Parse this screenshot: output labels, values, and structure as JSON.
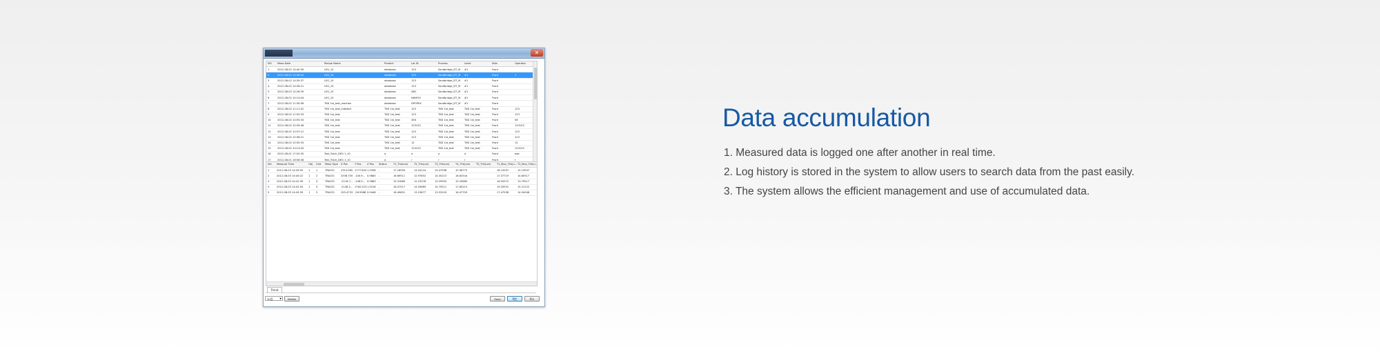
{
  "screenshot": {
    "top_table": {
      "columns": [
        "NO.",
        "Meas Date",
        "Recipe Name",
        "Product",
        "Lot ID",
        "Process",
        "Level",
        "Side",
        "Operator"
      ],
      "selected_index": 1,
      "rows": [
        [
          "1",
          "2012-08-02 14:40:39",
          "LEG_10",
          "database",
          "123",
          "Sandbridge_DT_M",
          "#1",
          "Front",
          ""
        ],
        [
          "2",
          "2012-08-02 14:36:20",
          "LEG_10",
          "database",
          "123",
          "Sandbridge_DT_M",
          "#1",
          "Front",
          "1"
        ],
        [
          "3",
          "2012-08-02 14:35:37",
          "LEG_10",
          "database",
          "123",
          "Sandbridge_DT_M",
          "#1",
          "Front",
          ""
        ],
        [
          "4",
          "2012-08-02 14:28:21",
          "LEG_10",
          "database",
          "123",
          "Sandbridge_DT_M",
          "#1",
          "Front",
          ""
        ],
        [
          "5",
          "2012-08-02 14:26:39",
          "LEG_10",
          "database",
          "ABC",
          "Sandbridge_DT_M",
          "#1",
          "Front",
          ""
        ],
        [
          "6",
          "2012-08-02 14:14:04",
          "LEG_10",
          "database",
          "NAMOO",
          "Sandbridge_DT_M",
          "#1",
          "Front",
          ""
        ],
        [
          "7",
          "2012-08-02 11:30:56",
          "TKD 1st_test_reaction",
          "database",
          "DPOPEA",
          "Sandbridge_DT_M",
          "#1",
          "Front",
          ""
        ],
        [
          "8",
          "2012-08-02 11:11:02",
          "TKD 1st_test_indexed",
          "TKD 1st_test",
          "123",
          "TKD 1st_test",
          "TKD 1st_test",
          "Front",
          "123"
        ],
        [
          "9",
          "2012-08-02 11:03:33",
          "TKD 1st_test",
          "TKD 1st_test",
          "123",
          "TKD 1st_test",
          "TKD 1st_test",
          "Front",
          "123"
        ],
        [
          "10",
          "2012-08-02 10:55:34",
          "TKD 1st_test",
          "TKD 1st_test",
          "456",
          "TKD 1st_test",
          "TKD 1st_test",
          "Front",
          "56"
        ],
        [
          "11",
          "2012-08-02 10:39:46",
          "TKD 1st_test",
          "TKD 1st_test",
          "123123",
          "TKD 1st_test",
          "TKD 1st_test",
          "Front",
          "123123"
        ],
        [
          "12",
          "2012-08-02 10:37:12",
          "TKD 1st_test",
          "TKD 1st_test",
          "123",
          "TKD 1st_test",
          "TKD 1st_test",
          "Front",
          "123"
        ],
        [
          "13",
          "2012-08-02 10:36:21",
          "TKD 1st_test",
          "TKD 1st_test",
          "123",
          "TKD 1st_test",
          "TKD 1st_test",
          "Front",
          "123"
        ],
        [
          "14",
          "2012-08-02 10:30:33",
          "TKD 1st_test",
          "TKD 1st_test",
          "12",
          "TKD 1st_test",
          "TKD 1st_test",
          "Front",
          "12"
        ],
        [
          "15",
          "2012-08-02 10:13:04",
          "TKD 1st_test",
          "TKD 1st_test",
          "123123",
          "TKD 1st_test",
          "TKD 1st_test",
          "Front",
          "123123"
        ],
        [
          "16",
          "2012-08-01 17:02:50",
          "Test_Track_DEG 1_10",
          "a",
          "a",
          "a",
          "a",
          "Front",
          "aaa"
        ],
        [
          "17",
          "2012-08-01 16:58:38",
          "Test_Track_DEG 1_10",
          "a",
          "r",
          "r",
          "r",
          "Front",
          "r"
        ]
      ]
    },
    "bottom_table": {
      "columns": [
        "NO.",
        "Measure Time",
        "Obj",
        "Unit",
        "Meas Type",
        "X Pos",
        "Y Pos",
        "Z Pos",
        "Status",
        "T1_Thk(um)",
        "T2_Thk(um)",
        "T3_Thk(um)",
        "T4_Thk(um)",
        "T5_Thk(um)",
        "T1_Max_Thk(u...",
        "T2_Max_Thk(u..."
      ],
      "rows": [
        [
          "1",
          "2012-08-03 14:39:59",
          "1",
          "1",
          "TRACE1",
          "2313.085",
          "1777.843",
          "1.5358",
          "-",
          "17.18994",
          "14.54124",
          "14.47998",
          "15.96775",
          "",
          "18.13597",
          "15.13597"
        ],
        [
          "2",
          "2012-08-03 14:40:22",
          "1",
          "2",
          "TRACE1",
          "2536.705",
          "-100.9...",
          "0.9883",
          "-",
          "16.89511",
          "12.97852",
          "14.35215",
          "16.62544",
          "",
          "17.37719",
          "14.65517"
        ],
        [
          "3",
          "2012-08-03 14:41:39",
          "1",
          "3",
          "TRACE1",
          "-2116.7...",
          "-106.9...",
          "0.9883",
          "-",
          "15.31689",
          "12.23378",
          "13.29955",
          "15.29685",
          "",
          "16.50572",
          "13.79517"
        ],
        [
          "4",
          "2012-08-03 14:42:54",
          "1",
          "4",
          "TRACE1",
          "-2138.2...",
          "1762.523",
          "1.5516",
          "-",
          "18.07517",
          "14.59685",
          "14.75511",
          "17.65213",
          "",
          "19.03531",
          "15.21122"
        ],
        [
          "5",
          "2012-08-03 14:43:39",
          "1",
          "5",
          "TRACE1",
          "255.4733",
          "-28.5988",
          "0.9448",
          "-",
          "16.49651",
          "13.23677",
          "13.53243",
          "16.47709",
          "",
          "17.47558",
          "14.04048"
        ]
      ]
    },
    "tab_label": "Trend",
    "combo_value": "30일",
    "buttons": {
      "delete": "Delete",
      "save": "Save",
      "confirm": "확인",
      "cancel": "취소"
    }
  },
  "heading": "Data accumulation",
  "points": [
    "1. Measured data is logged one after another in real time.",
    "2. Log history is stored in the system to allow users to search data from the past easily.",
    "3. The system allows the efficient management and use of accumulated data."
  ],
  "colors": {
    "heading": "#1659a4",
    "selection": "#3399ff",
    "body_text": "#444444"
  }
}
